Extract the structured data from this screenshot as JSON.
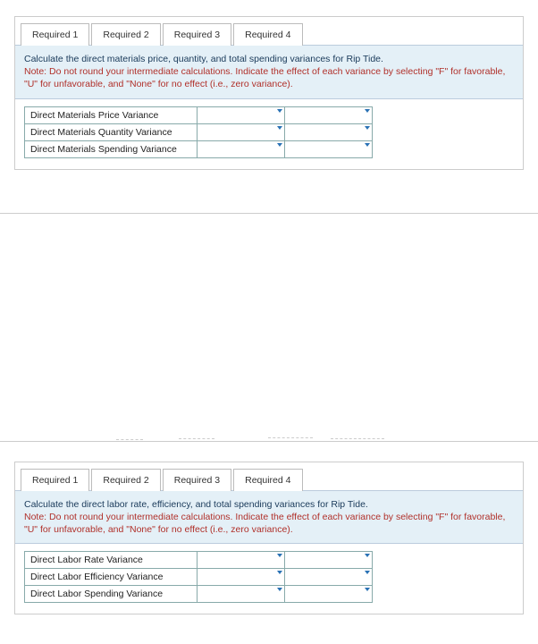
{
  "block1": {
    "tabs": [
      {
        "label": "Required 1"
      },
      {
        "label": "Required 2"
      },
      {
        "label": "Required 3"
      },
      {
        "label": "Required 4"
      }
    ],
    "active_tab_index": 0,
    "instruction_main": "Calculate the direct materials price, quantity, and total spending variances for Rip Tide.",
    "instruction_note": "Note: Do not round your intermediate calculations. Indicate the effect of each variance by selecting \"F\" for favorable, \"U\" for unfavorable, and \"None\" for no effect (i.e., zero variance).",
    "rows": [
      {
        "label": "Direct Materials Price Variance",
        "value": "",
        "effect": ""
      },
      {
        "label": "Direct Materials Quantity Variance",
        "value": "",
        "effect": ""
      },
      {
        "label": "Direct Materials Spending Variance",
        "value": "",
        "effect": ""
      }
    ]
  },
  "block2": {
    "tabs": [
      {
        "label": "Required 1"
      },
      {
        "label": "Required 2"
      },
      {
        "label": "Required 3"
      },
      {
        "label": "Required 4"
      }
    ],
    "active_tab_index": 1,
    "instruction_main": "Calculate the direct labor rate, efficiency, and total spending variances for Rip Tide.",
    "instruction_note": "Note: Do not round your intermediate calculations. Indicate the effect of each variance by selecting \"F\" for favorable, \"U\" for unfavorable, and \"None\" for no effect (i.e., zero variance).",
    "rows": [
      {
        "label": "Direct Labor Rate Variance",
        "value": "",
        "effect": ""
      },
      {
        "label": "Direct Labor Efficiency Variance",
        "value": "",
        "effect": ""
      },
      {
        "label": "Direct Labor Spending Variance",
        "value": "",
        "effect": ""
      }
    ]
  }
}
